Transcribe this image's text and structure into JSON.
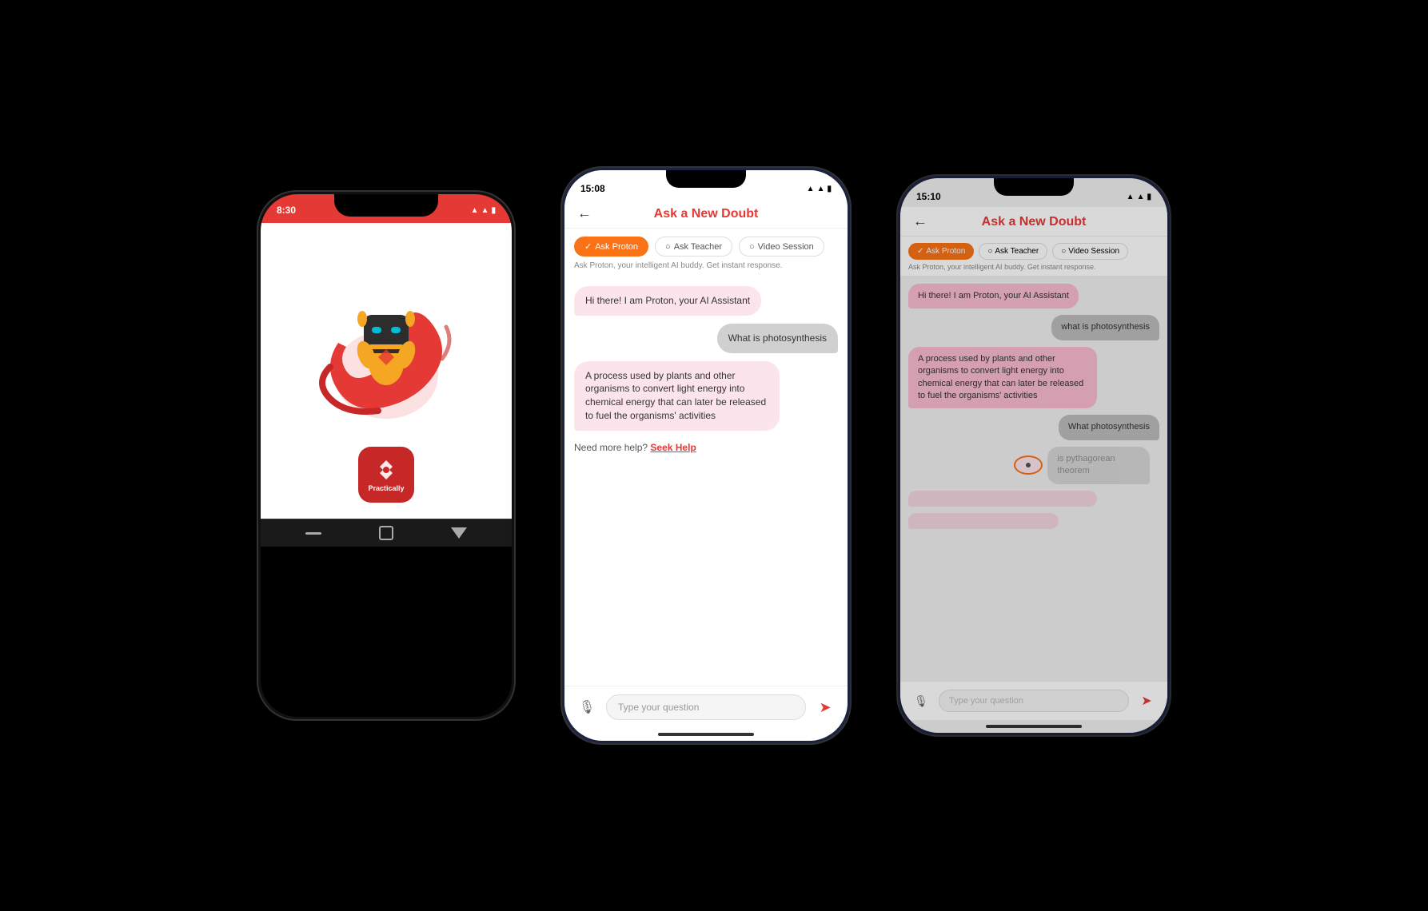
{
  "app": {
    "name": "Practically",
    "ai_name": "Proton"
  },
  "left_phone": {
    "status_bar": {
      "time": "8:30",
      "icons": "▲ ▐▐▐ ▮"
    },
    "logo_text": "Practically"
  },
  "middle_phone": {
    "status_bar": {
      "time": "15:08",
      "icons": "▲ ▐▐ ▮"
    },
    "header": {
      "back_arrow": "←",
      "title": "Ask a New Doubt"
    },
    "tabs": [
      {
        "label": "Ask Proton",
        "active": true
      },
      {
        "label": "Ask Teacher",
        "active": false
      },
      {
        "label": "Video Session",
        "active": false
      }
    ],
    "subtitle": "Ask Proton, your intelligent AI buddy. Get instant response.",
    "messages": [
      {
        "side": "left",
        "text": "Hi there! I am Proton, your AI Assistant"
      },
      {
        "side": "right",
        "text": "What is photosynthesis"
      },
      {
        "side": "left",
        "text": "A process used by plants and other organisms to convert light energy into chemical energy that can later be released to fuel the organisms' activities"
      }
    ],
    "seek_help": "Need more help?",
    "seek_help_link": "Seek Help",
    "input_placeholder": "Type your question"
  },
  "right_phone": {
    "status_bar": {
      "time": "15:10",
      "icons": "▲ ▐▐▐ ▮"
    },
    "header": {
      "back_arrow": "←",
      "title": "Ask a New Doubt"
    },
    "tabs": [
      {
        "label": "Ask Proton",
        "active": true
      },
      {
        "label": "Ask Teacher",
        "active": false
      },
      {
        "label": "Video Session",
        "active": false
      }
    ],
    "subtitle": "Ask Proton, your intelligent AI buddy. Get instant response.",
    "messages": [
      {
        "side": "left",
        "text": "Hi there! I am Proton, your AI Assistant"
      },
      {
        "side": "right",
        "text": "what is photosynthesis"
      },
      {
        "side": "left",
        "text": "A process used by plants and other organisms to convert light energy into chemical energy that can later be released to fuel the organisms' activities"
      },
      {
        "side": "right",
        "text": "What photosynthesis"
      },
      {
        "side": "left_faded",
        "text": ""
      }
    ],
    "typing_text": "is pythagorean theorem",
    "input_placeholder": "Type your question"
  }
}
